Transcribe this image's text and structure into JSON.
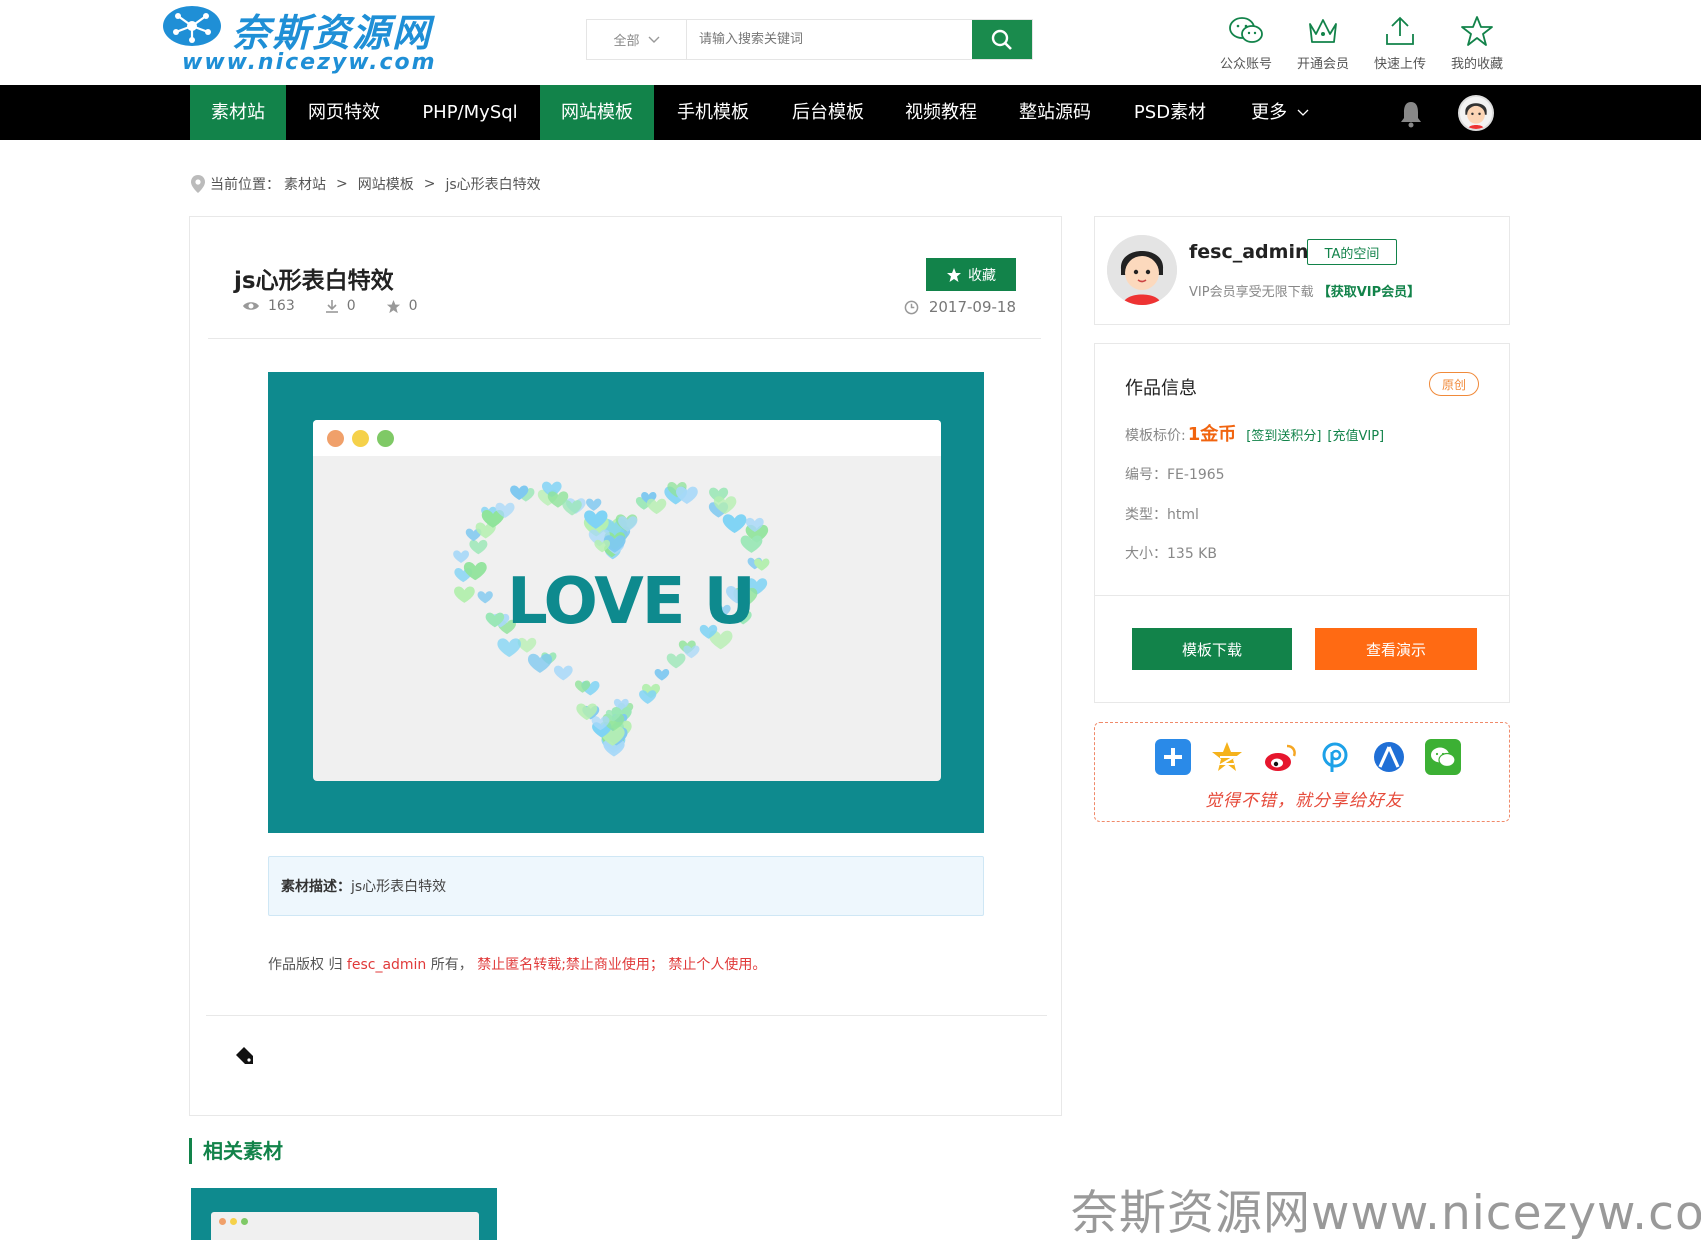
{
  "header": {
    "logo_cn": "奈斯资源网",
    "logo_url": "www.nicezyw.com",
    "search": {
      "category": "全部",
      "placeholder": "请输入搜索关键词"
    },
    "quick_links": [
      {
        "label": "公众账号",
        "icon": "wechat-icon"
      },
      {
        "label": "开通会员",
        "icon": "crown-icon"
      },
      {
        "label": "快速上传",
        "icon": "upload-icon"
      },
      {
        "label": "我的收藏",
        "icon": "star-icon"
      }
    ]
  },
  "nav": {
    "items": [
      {
        "label": "素材站",
        "active": true
      },
      {
        "label": "网页特效",
        "active": false
      },
      {
        "label": "PHP/MySql",
        "active": false
      },
      {
        "label": "网站模板",
        "active": true
      },
      {
        "label": "手机模板",
        "active": false
      },
      {
        "label": "后台模板",
        "active": false
      },
      {
        "label": "视频教程",
        "active": false
      },
      {
        "label": "整站源码",
        "active": false
      },
      {
        "label": "PSD素材",
        "active": false
      },
      {
        "label": "更多",
        "active": false
      }
    ]
  },
  "breadcrumb": {
    "prefix": "当前位置：",
    "items": [
      "素材站",
      "网站模板",
      "js心形表白特效"
    ],
    "sep": ">"
  },
  "article": {
    "title": "js心形表白特效",
    "fav_label": "收藏",
    "views": "163",
    "downloads": "0",
    "stars": "0",
    "date": "2017-09-18",
    "preview_text": "LOVE U",
    "desc_label": "素材描述：",
    "desc_text": "js心形表白特效",
    "copyright_prefix": "作品版权 归 ",
    "copyright_author": "fesc_admin",
    "copyright_mid": " 所有， ",
    "copyright_rules": "禁止匿名转载;禁止商业使用； 禁止个人使用。"
  },
  "related": {
    "title": "相关素材"
  },
  "author": {
    "name": "fesc_admin",
    "space_label": "TA的空间",
    "vip_text": "VIP会员享受无限下载",
    "vip_link": "【获取VIP会员】"
  },
  "info": {
    "title": "作品信息",
    "badge": "原创",
    "price_label": "模板标价:",
    "price_value": "1金币",
    "price_link1": "[签到送积分]",
    "price_link2": "[充值VIP]",
    "code_label": "编号：",
    "code_value": "FE-1965",
    "type_label": "类型：",
    "type_value": "html",
    "size_label": "大小：",
    "size_value": "135 KB",
    "download_label": "模板下载",
    "demo_label": "查看演示"
  },
  "share": {
    "text": "觉得不错，就分享给好友",
    "icons": [
      "share-plus-icon",
      "qzone-icon",
      "weibo-icon",
      "pinterest-icon",
      "renren-icon",
      "wechat-share-icon"
    ]
  },
  "watermark": "奈斯资源网www.nicezyw.com",
  "colors": {
    "green": "#12834a",
    "orange": "#ff6a13",
    "teal": "#0e8a8e",
    "red": "#e03a3a"
  }
}
